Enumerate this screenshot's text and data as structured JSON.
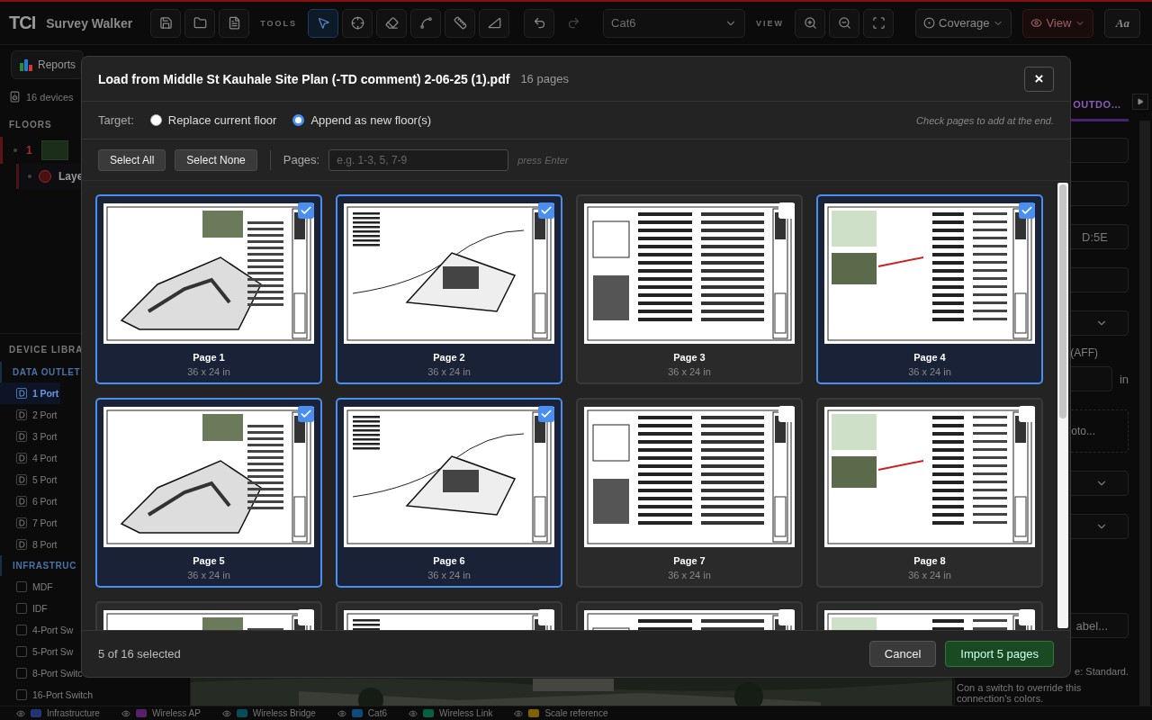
{
  "toolbar": {
    "logo": "TCI",
    "app_name": "Survey Walker",
    "file_tools": [
      {
        "kind": "save"
      },
      {
        "kind": "open"
      },
      {
        "kind": "document"
      }
    ],
    "tools_label": "TOOLS",
    "tools": [
      {
        "kind": "select",
        "selected": true
      },
      {
        "kind": "point",
        "selected": false
      },
      {
        "kind": "eraser",
        "selected": false
      },
      {
        "kind": "line",
        "selected": false
      },
      {
        "kind": "measure",
        "selected": false
      },
      {
        "kind": "angle",
        "selected": false
      }
    ],
    "history": [
      {
        "kind": "undo",
        "disabled": false
      },
      {
        "kind": "redo",
        "disabled": true
      }
    ],
    "cable_select": {
      "value": "Cat6"
    },
    "view_label": "VIEW",
    "view_tools": [
      {
        "kind": "zoom-in"
      },
      {
        "kind": "zoom-out"
      },
      {
        "kind": "fit"
      }
    ],
    "coverage_button": "Coverage",
    "view_button": "View",
    "font_button": "Aa"
  },
  "subbar": {
    "reports_button": "Reports"
  },
  "sidebar": {
    "device_count": "16 devices",
    "floors_heading": "FLOORS",
    "floors": [
      {
        "number": "1",
        "layers": [
          {
            "label": "Laye"
          }
        ]
      }
    ],
    "library_heading": "DEVICE LIBRA",
    "groups": [
      {
        "heading": "DATA OUTLET",
        "items": [
          {
            "kind": "outlet",
            "label": "1 Port",
            "selected": true
          },
          {
            "kind": "outlet",
            "label": "2 Port",
            "selected": false
          },
          {
            "kind": "outlet",
            "label": "3 Port",
            "selected": false
          },
          {
            "kind": "outlet",
            "label": "4 Port",
            "selected": false
          },
          {
            "kind": "outlet",
            "label": "5 Port",
            "selected": false
          },
          {
            "kind": "outlet",
            "label": "6 Port",
            "selected": false
          },
          {
            "kind": "outlet",
            "label": "7 Port",
            "selected": false
          },
          {
            "kind": "outlet",
            "label": "8 Port",
            "selected": false
          }
        ]
      },
      {
        "heading": "INFRASTRUC",
        "items": [
          {
            "kind": "box",
            "label": "MDF",
            "selected": false
          },
          {
            "kind": "box",
            "label": "IDF",
            "selected": false
          },
          {
            "kind": "box",
            "label": "4-Port Sw",
            "selected": false
          },
          {
            "kind": "box",
            "label": "5-Port Sw",
            "selected": false
          },
          {
            "kind": "box",
            "label": "8-Port Switc",
            "selected": false
          },
          {
            "kind": "box",
            "label": "16-Port Switch",
            "selected": false
          }
        ]
      }
    ]
  },
  "right_panel": {
    "tab": "OUTDO…",
    "fields": [
      {
        "kind": "input"
      },
      {
        "kind": "input"
      },
      {
        "kind": "input",
        "value": "D:5E"
      },
      {
        "kind": "input"
      },
      {
        "kind": "select"
      },
      {
        "kind": "label",
        "text": "(AFF)"
      },
      {
        "kind": "unit_input",
        "unit": "in"
      },
      {
        "kind": "dropzone",
        "text": "oto..."
      },
      {
        "kind": "select"
      },
      {
        "kind": "select"
      },
      {
        "kind": "input",
        "placeholder": "abel..."
      },
      {
        "kind": "note",
        "text": "e: Standard."
      },
      {
        "kind": "note",
        "text": "Con a switch to override this connection's colors."
      }
    ]
  },
  "legend": [
    {
      "label": "Infrastructure",
      "color": "#233477"
    },
    {
      "label": "Wireless AP",
      "color": "#5a1f69"
    },
    {
      "label": "Wireless Bridge",
      "color": "#074d59"
    },
    {
      "label": "Cat6",
      "color": "#10497c"
    },
    {
      "label": "Wireless Link",
      "color": "#076046"
    },
    {
      "label": "Scale reference",
      "color": "#826200"
    }
  ],
  "modal": {
    "title": "Load from Middle St Kauhale Site Plan (-TD comment) 2-06-25 (1).pdf",
    "page_count": "16 pages",
    "close": "×",
    "target_label": "Target:",
    "targets": [
      {
        "label": "Replace current floor",
        "selected": false
      },
      {
        "label": "Append as new floor(s)",
        "selected": true
      }
    ],
    "hint": "Check pages to add at the end.",
    "select_all": "Select All",
    "select_none": "Select None",
    "pages_label": "Pages:",
    "pages_placeholder": "e.g. 1-3, 5, 7-9",
    "enter_hint": "press Enter",
    "pages": [
      {
        "label": "Page 1",
        "size": "36 x 24 in",
        "selected": true
      },
      {
        "label": "Page 2",
        "size": "36 x 24 in",
        "selected": true
      },
      {
        "label": "Page 3",
        "size": "36 x 24 in",
        "selected": false
      },
      {
        "label": "Page 4",
        "size": "36 x 24 in",
        "selected": true
      },
      {
        "label": "Page 5",
        "size": "36 x 24 in",
        "selected": true
      },
      {
        "label": "Page 6",
        "size": "36 x 24 in",
        "selected": true
      },
      {
        "label": "Page 7",
        "size": "36 x 24 in",
        "selected": false
      },
      {
        "label": "Page 8",
        "size": "36 x 24 in",
        "selected": false
      },
      {
        "selected": false
      },
      {
        "selected": false
      },
      {
        "selected": false
      },
      {
        "selected": false
      }
    ],
    "status": "5 of 16 selected",
    "cancel": "Cancel",
    "import": "Import 5 pages"
  }
}
